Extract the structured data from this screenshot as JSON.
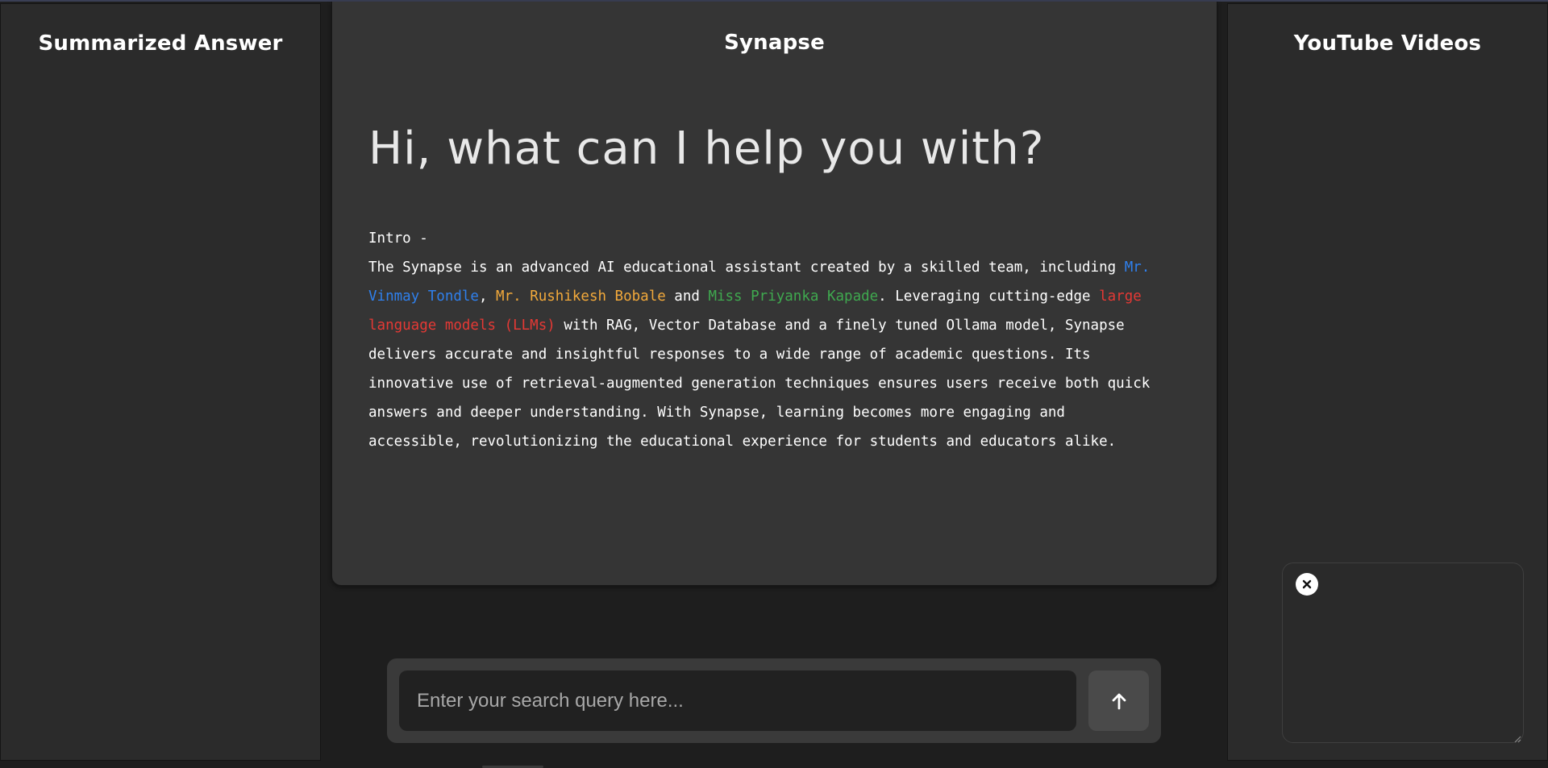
{
  "left_panel": {
    "title": "Summarized Answer"
  },
  "center": {
    "title": "Synapse",
    "hero": "Hi, what can I help you with?",
    "intro_heading": "Intro -",
    "intro": {
      "p1": "The Synapse is an advanced AI educational assistant created by a skilled team, including ",
      "name1": "Mr. Vinmay Tondle",
      "sep1": ", ",
      "name2": "Mr. Rushikesh Bobale",
      "sep2": " and ",
      "name3": "Miss Priyanka Kapade",
      "p2": ". Leveraging cutting-edge ",
      "llm": "large language models (LLMs)",
      "p3": " with RAG, Vector Database and a finely tuned Ollama model, Synapse delivers accurate and insightful responses to a wide range of academic questions. Its innovative use of retrieval-augmented generation techniques ensures users receive both quick answers and deeper understanding. With Synapse, learning becomes more engaging and accessible, revolutionizing the educational experience for students and educators alike."
    }
  },
  "right_panel": {
    "title": "YouTube Videos"
  },
  "search": {
    "placeholder": "Enter your search query here...",
    "value": "",
    "send_icon": "arrow-up-icon"
  },
  "video_box": {
    "close_icon": "close-icon"
  },
  "colors": {
    "background": "#1e1e1e",
    "panel": "#2b2b2b",
    "card": "#353535",
    "name_blue": "#2f80ed",
    "name_orange": "#f2a93b",
    "name_green": "#3fa94f",
    "highlight_red": "#e53935"
  }
}
